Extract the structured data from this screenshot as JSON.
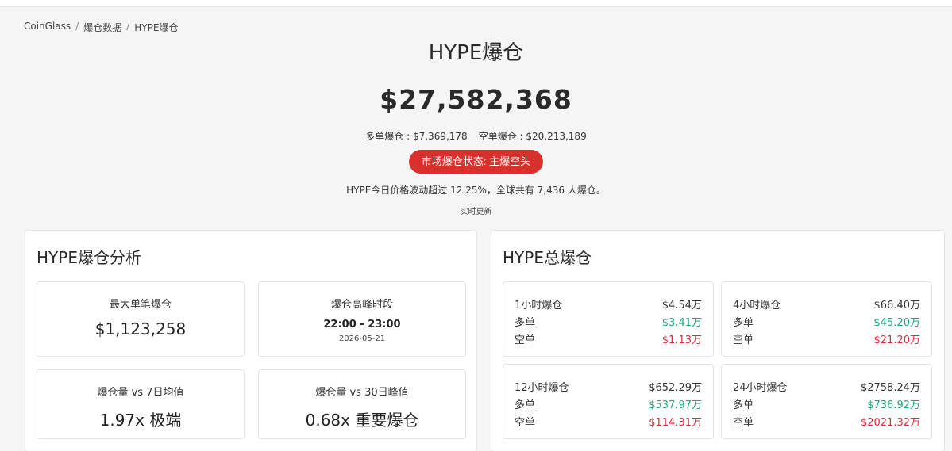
{
  "breadcrumb": [
    "CoinGlass",
    "爆仓数据",
    "HYPE爆仓"
  ],
  "header": {
    "title": "HYPE爆仓",
    "total": "$27,582,368",
    "long_text": "多单爆仓 : $7,369,178",
    "short_text": "空单爆仓 : $20,213,189",
    "status_label": "市场爆仓状态: 主爆空头",
    "description": "HYPE今日价格波动超过 12.25%，全球共有 7,436 人爆仓。",
    "realtime": "实时更新"
  },
  "analysis": {
    "title": "HYPE爆仓分析",
    "cards": [
      {
        "label": "最大单笔爆仓",
        "value": "$1,123,258"
      },
      {
        "label": "爆仓高峰时段",
        "value": "22:00 - 23:00",
        "sub": "2026-05-21"
      },
      {
        "label": "爆仓量 vs 7日均值",
        "value": "1.97x 极端"
      },
      {
        "label": "爆仓量 vs 30日峰值",
        "value": "0.68x 重要爆仓"
      }
    ]
  },
  "total_liq": {
    "title": "HYPE总爆仓",
    "long_label": "多单",
    "short_label": "空单",
    "cards": [
      {
        "label": "1小时爆仓",
        "total": "$4.54万",
        "long": "$3.41万",
        "short": "$1.13万"
      },
      {
        "label": "4小时爆仓",
        "total": "$66.40万",
        "long": "$45.20万",
        "short": "$21.20万"
      },
      {
        "label": "12小时爆仓",
        "total": "$652.29万",
        "long": "$537.97万",
        "short": "$114.31万"
      },
      {
        "label": "24小时爆仓",
        "total": "$2758.24万",
        "long": "$736.92万",
        "short": "$2021.32万"
      }
    ]
  },
  "colors": {
    "long": "#1aaa74",
    "short": "#e0283c",
    "status_bg": "#d7302d"
  }
}
